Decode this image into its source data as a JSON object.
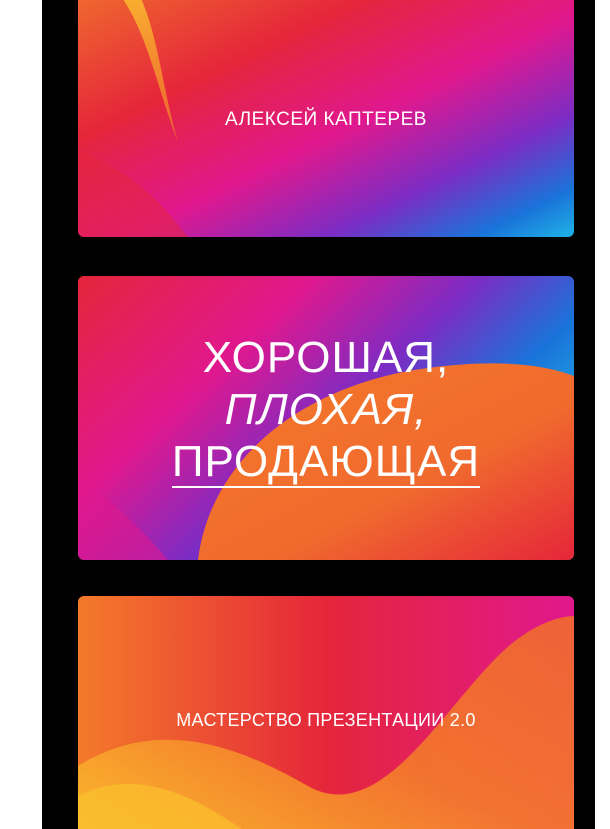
{
  "author": "АЛЕКСЕЙ КАПТЕРЕВ",
  "title": {
    "line1": "ХОРОШАЯ,",
    "line2": "ПЛОХАЯ,",
    "line3": "ПРОДАЮЩАЯ"
  },
  "subtitle": "МАСТЕРСТВО ПРЕЗЕНТАЦИИ 2.0",
  "colors": {
    "background": "#000000",
    "red": "#e5263a",
    "magenta": "#e0188e",
    "purple": "#7b2cc4",
    "blue": "#1a73d9",
    "cyan": "#1fb3e6",
    "orange": "#f47a2a",
    "yellow": "#fbc12e"
  }
}
